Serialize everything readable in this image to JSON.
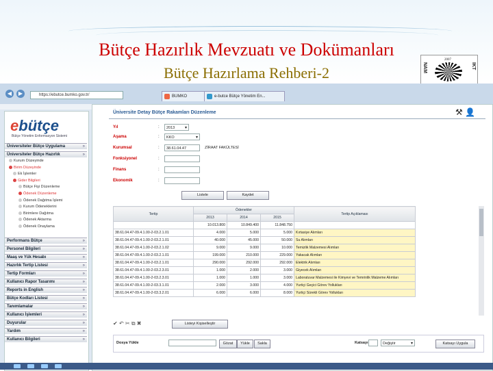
{
  "slide": {
    "title": "Bütçe Hazırlık Mevzuatı ve Dokümanları",
    "subtitle": "Bütçe Hazırlama Rehberi-2",
    "logo_year": "2007",
    "logo_left": "NAM",
    "logo_right": "IKT"
  },
  "browser": {
    "address": "https://ebutce.bumko.gov.tr/",
    "tabs": [
      "BUMKO",
      "e-butce Bütçe Yönetim En..."
    ]
  },
  "sidebar": {
    "logo_e": "e",
    "logo_rest": "bütçe",
    "logo_sub": "Bütçe Yönetim Enformasyon Sistemi",
    "sections_top": [
      "Üniversiteler Bütçe Uygulama",
      "Üniversiteler Bütçe Hazırlık"
    ],
    "tree": [
      {
        "label": "Kurum Düzeyinde",
        "red": false
      },
      {
        "label": "Birim Düzeyinde",
        "red": true
      },
      {
        "label": "Ek İşlemler",
        "red": false
      },
      {
        "label": "Gider Bilgileri",
        "red": true
      },
      {
        "label": "Bütçe Fişi Düzenleme",
        "red": false
      },
      {
        "label": "Ödenek Düzenleme",
        "red": true
      },
      {
        "label": "Ödenek Dağıtma İşlemi",
        "red": false
      },
      {
        "label": "Kurum Ödeneklerini",
        "red": false
      },
      {
        "label": "Birimlere Dağıtma",
        "red": false
      },
      {
        "label": "Ödenek Aktarma",
        "red": false
      },
      {
        "label": "Ödenek Onaylama",
        "red": false
      }
    ],
    "sections_bottom": [
      "Performans Bütçe",
      "Personel Bilgileri",
      "Maaş ve Yük Hesabı",
      "Hazırlık Tertip Listesi",
      "Tertip Formları",
      "Kullanıcı Rapor Tasarımı",
      "Reports in English",
      "Bütçe Kodları Listesi",
      "Tanımlamalar",
      "Kullanıcı İşlemleri",
      "Duyurular",
      "Yardım",
      "Kullanıcı Bilgileri"
    ]
  },
  "main": {
    "title": "Üniversite Detay Bütçe Rakamları Düzenleme",
    "form": {
      "labels": [
        "Yıl",
        "Aşama",
        "Kurumsal",
        "Fonksiyonel",
        "Finans",
        "Ekonomik"
      ],
      "yil": "2013",
      "asama": "KKO",
      "kurumsal_code": "38.61.04.47",
      "kurumsal_name": "ZİRAAT FAKÜLTESİ",
      "listele": "Listele",
      "kaydet": "Kaydet"
    },
    "grid": {
      "group_header": "Ödenekler",
      "col_tertip": "Tertip",
      "col_years": [
        "2013",
        "2014",
        "2015"
      ],
      "col_desc": "Tertip Açıklaması",
      "totals": [
        "10.013.800",
        "10.849.400",
        "11.848.750"
      ],
      "rows": [
        {
          "tertip": "38.61.04.47-09.4.1.00-2-03.2.1.01",
          "v": [
            "4.000",
            "5.000",
            "5.000"
          ],
          "desc": "Kırtasiye Alımları"
        },
        {
          "tertip": "38.61.04.47-09.4.1.00-2-03.2.1.01",
          "v": [
            "40.000",
            "45.000",
            "50.000"
          ],
          "desc": "Su Alımları"
        },
        {
          "tertip": "38.61.04.47-09.4.1.00-2-03.2.1.02",
          "v": [
            "9.000",
            "9.000",
            "10.000"
          ],
          "desc": "Temizlik Malzemesi Alımları"
        },
        {
          "tertip": "38.61.04.47-09.4.1.00-2-03.2.1.01",
          "v": [
            "199.000",
            "210.000",
            "229.000"
          ],
          "desc": "Yakacak Alımları"
        },
        {
          "tertip": "38.61.04.47-09.4.1.00-2-03.2.1.01",
          "v": [
            "290.000",
            "292.000",
            "292.000"
          ],
          "desc": "Elektrik Alımları"
        },
        {
          "tertip": "38.61.04.47-09.4.1.00-2-03.2.3.01",
          "v": [
            "1.000",
            "2.000",
            "3.000"
          ],
          "desc": "Giyecek Alımları"
        },
        {
          "tertip": "38.61.04.47-09.4.1.00-2-03.2.3.01",
          "v": [
            "1.000",
            "1.000",
            "3.000"
          ],
          "desc": "Laboratuvar Malzemesi ile Kimyevi ve Temrinlik Malzeme Alımları"
        },
        {
          "tertip": "38.61.04.47-09.4.1.00-2-03.3.1.01",
          "v": [
            "2.000",
            "3.000",
            "4.000"
          ],
          "desc": "Yurtiçi Geçici Görev Yollukları"
        },
        {
          "tertip": "38.61.04.47-09.4.1.00-2-03.3.2.01",
          "v": [
            "6.000",
            "6.000",
            "8.000"
          ],
          "desc": "Yurtiçi Sürekli Görev Yollukları"
        }
      ]
    },
    "listeyi_kisisellestir": "Listeyi Kişiselleştir",
    "bottom": {
      "dosya_yukle": "Dosya Yükle",
      "gozat": "Gözat",
      "yukle": "Yükle",
      "sakla": "Sakla",
      "katsayi_label": "Katsayı",
      "katsayi_value": "Değiştir",
      "katsayi_uygula": "Katsayı Uygula"
    }
  }
}
